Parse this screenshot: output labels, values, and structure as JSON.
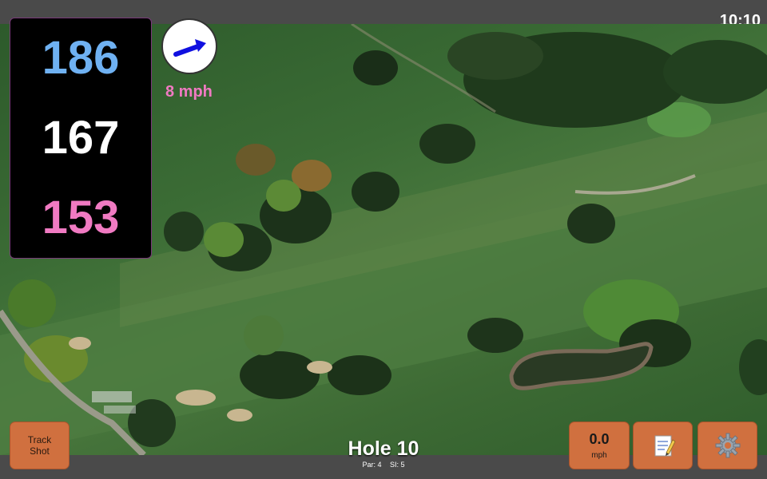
{
  "clock": {
    "time": "10:10"
  },
  "distances": {
    "back": "186",
    "middle": "167",
    "front": "153"
  },
  "wind": {
    "speed_label": "8 mph",
    "direction_icon": "arrow-icon"
  },
  "hole": {
    "title": "Hole 10",
    "par": "Par: 4",
    "si": "SI: 5"
  },
  "buttons": {
    "track_shot": "Track Shot",
    "speed_value": "0.0",
    "speed_unit": "mph",
    "notes_icon": "notepad-icon",
    "settings_icon": "gear-icon"
  },
  "colors": {
    "back": "#6fb1f2",
    "middle": "#ffffff",
    "front": "#f07ac2",
    "wind_label": "#f07ac2",
    "button": "#d0703f"
  }
}
